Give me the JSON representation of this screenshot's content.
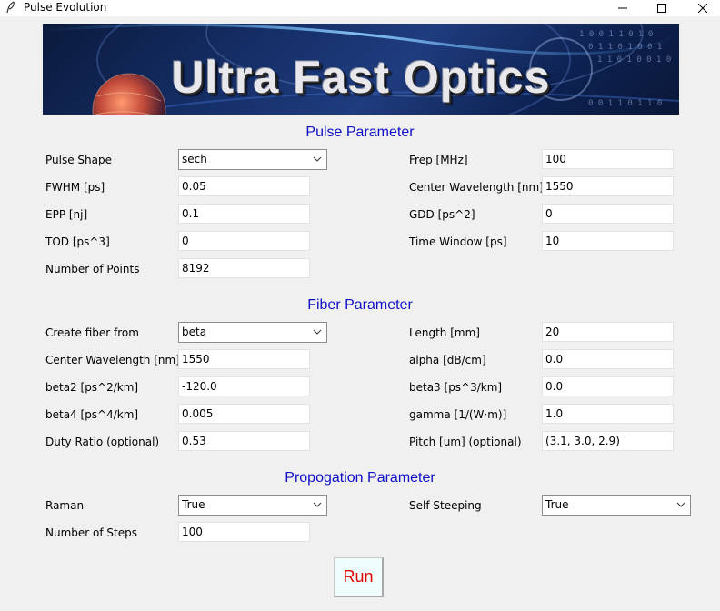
{
  "window": {
    "title": "Pulse Evolution"
  },
  "banner": {
    "title": "Ultra Fast Optics"
  },
  "pulse": {
    "section_title": "Pulse Parameter",
    "shape": {
      "label": "Pulse Shape",
      "value": "sech"
    },
    "frep": {
      "label": "Frep [MHz]",
      "value": "100"
    },
    "fwhm": {
      "label": "FWHM [ps]",
      "value": "0.05"
    },
    "center_wavelength": {
      "label": "Center Wavelength [nm]",
      "value": "1550"
    },
    "epp": {
      "label": "EPP [nj]",
      "value": "0.1"
    },
    "gdd": {
      "label": "GDD [ps^2]",
      "value": "0"
    },
    "tod": {
      "label": "TOD [ps^3]",
      "value": "0"
    },
    "time_window": {
      "label": "Time Window [ps]",
      "value": "10"
    },
    "points": {
      "label": "Number of Points",
      "value": "8192"
    }
  },
  "fiber": {
    "section_title": "Fiber Parameter",
    "create_from": {
      "label": "Create fiber from",
      "value": "beta"
    },
    "length": {
      "label": "Length [mm]",
      "value": "20"
    },
    "center_wavelength": {
      "label": "Center Wavelength [nm]",
      "value": "1550"
    },
    "alpha": {
      "label": "alpha [dB/cm]",
      "value": "0.0"
    },
    "beta2": {
      "label": "beta2 [ps^2/km]",
      "value": "-120.0"
    },
    "beta3": {
      "label": "beta3 [ps^3/km]",
      "value": "0.0"
    },
    "beta4": {
      "label": "beta4 [ps^4/km]",
      "value": "0.005"
    },
    "gamma": {
      "label": "gamma [1/(W·m)]",
      "value": "1.0"
    },
    "duty": {
      "label": "Duty Ratio (optional)",
      "value": "0.53"
    },
    "pitch": {
      "label": "Pitch [um] (optional)",
      "value": "(3.1, 3.0, 2.9)"
    }
  },
  "propagation": {
    "section_title": "Propogation Parameter",
    "raman": {
      "label": "Raman",
      "value": "True"
    },
    "self_steeping": {
      "label": "Self Steeping",
      "value": "True"
    },
    "steps": {
      "label": "Number of Steps",
      "value": "100"
    }
  },
  "run_label": "Run",
  "colors": {
    "section": "#1010c8",
    "run_text": "#e00000"
  }
}
